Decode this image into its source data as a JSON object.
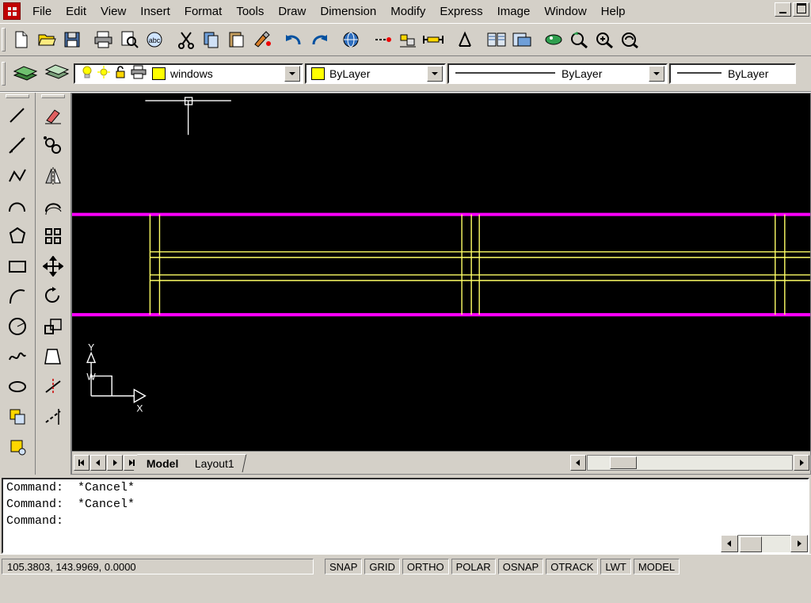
{
  "window": {
    "app_icon": "autocad-logo-icon",
    "minimize_label": "_",
    "restore_label": "restore"
  },
  "menu": {
    "items": [
      {
        "label": "File",
        "name": "menu-file"
      },
      {
        "label": "Edit",
        "name": "menu-edit"
      },
      {
        "label": "View",
        "name": "menu-view"
      },
      {
        "label": "Insert",
        "name": "menu-insert"
      },
      {
        "label": "Format",
        "name": "menu-format"
      },
      {
        "label": "Tools",
        "name": "menu-tools"
      },
      {
        "label": "Draw",
        "name": "menu-draw"
      },
      {
        "label": "Dimension",
        "name": "menu-dimension"
      },
      {
        "label": "Modify",
        "name": "menu-modify"
      },
      {
        "label": "Express",
        "name": "menu-express"
      },
      {
        "label": "Image",
        "name": "menu-image"
      },
      {
        "label": "Window",
        "name": "menu-window"
      },
      {
        "label": "Help",
        "name": "menu-help"
      }
    ]
  },
  "standard_toolbar": {
    "buttons": [
      "new-file-icon",
      "open-folder-icon",
      "save-disk-icon",
      "print-icon",
      "print-preview-icon",
      "spell-check-icon",
      "cut-scissors-icon",
      "copy-icon",
      "paste-icon",
      "match-properties-icon",
      "undo-icon",
      "redo-icon",
      "launch-browser-icon",
      "insert-hyperlink-icon",
      "object-snap-icon",
      "distance-icon",
      "dimension-style-icon",
      "block-editor-icon",
      "external-reference-icon",
      "pan-realtime-icon",
      "zoom-realtime-icon",
      "zoom-window-icon",
      "zoom-previous-icon"
    ]
  },
  "layer_toolbar": {
    "make_object_layer_icon": "make-object-layer-icon",
    "layer_previous_icon": "layer-previous-icon",
    "layer_state_icons": [
      "lightbulb-on-icon",
      "sun-freeze-icon",
      "unlock-icon",
      "plot-printer-icon"
    ],
    "layer_color_swatch": "#ffff00",
    "layer_name": "windows",
    "color_control": {
      "swatch": "#ffff00",
      "value": "ByLayer"
    },
    "linetype_control": {
      "value": "ByLayer"
    },
    "lineweight_control": {
      "value": "ByLayer"
    }
  },
  "draw_toolbar": {
    "buttons": [
      "line-icon",
      "construction-line-icon",
      "polyline-icon",
      "polygon-icon",
      "rectangle-icon",
      "arc-icon",
      "circle-icon",
      "spline-icon",
      "ellipse-icon",
      "insert-block-icon",
      "make-block-icon"
    ]
  },
  "modify_toolbar": {
    "buttons": [
      "erase-icon",
      "copy-object-icon",
      "mirror-icon",
      "offset-icon",
      "array-icon",
      "move-icon",
      "rotate-icon",
      "scale-icon",
      "stretch-icon",
      "trim-icon",
      "extend-icon"
    ]
  },
  "drawing": {
    "background_color": "#000000",
    "wall_line_color": "#ff00ff",
    "detail_line_color": "#ffff00",
    "crosshair_color": "#ffffff",
    "ucs_labels": {
      "y": "Y",
      "x": "X",
      "origin": "W"
    }
  },
  "layout_tabs": {
    "nav_first": "first-tab-icon",
    "nav_prev": "previous-tab-icon",
    "nav_next": "next-tab-icon",
    "nav_last": "last-tab-icon",
    "tabs": [
      {
        "label": "Model",
        "active": true
      },
      {
        "label": "Layout1",
        "active": false
      }
    ]
  },
  "command_window": {
    "history": [
      "Command:  *Cancel*",
      "Command:  *Cancel*"
    ],
    "prompt": "Command:"
  },
  "status_bar": {
    "coordinates": "105.3803, 143.9969, 0.0000",
    "toggles": [
      {
        "label": "SNAP",
        "active": false
      },
      {
        "label": "GRID",
        "active": false
      },
      {
        "label": "ORTHO",
        "active": false
      },
      {
        "label": "POLAR",
        "active": false
      },
      {
        "label": "OSNAP",
        "active": true
      },
      {
        "label": "OTRACK",
        "active": true
      },
      {
        "label": "LWT",
        "active": false
      },
      {
        "label": "MODEL",
        "active": false
      }
    ]
  }
}
